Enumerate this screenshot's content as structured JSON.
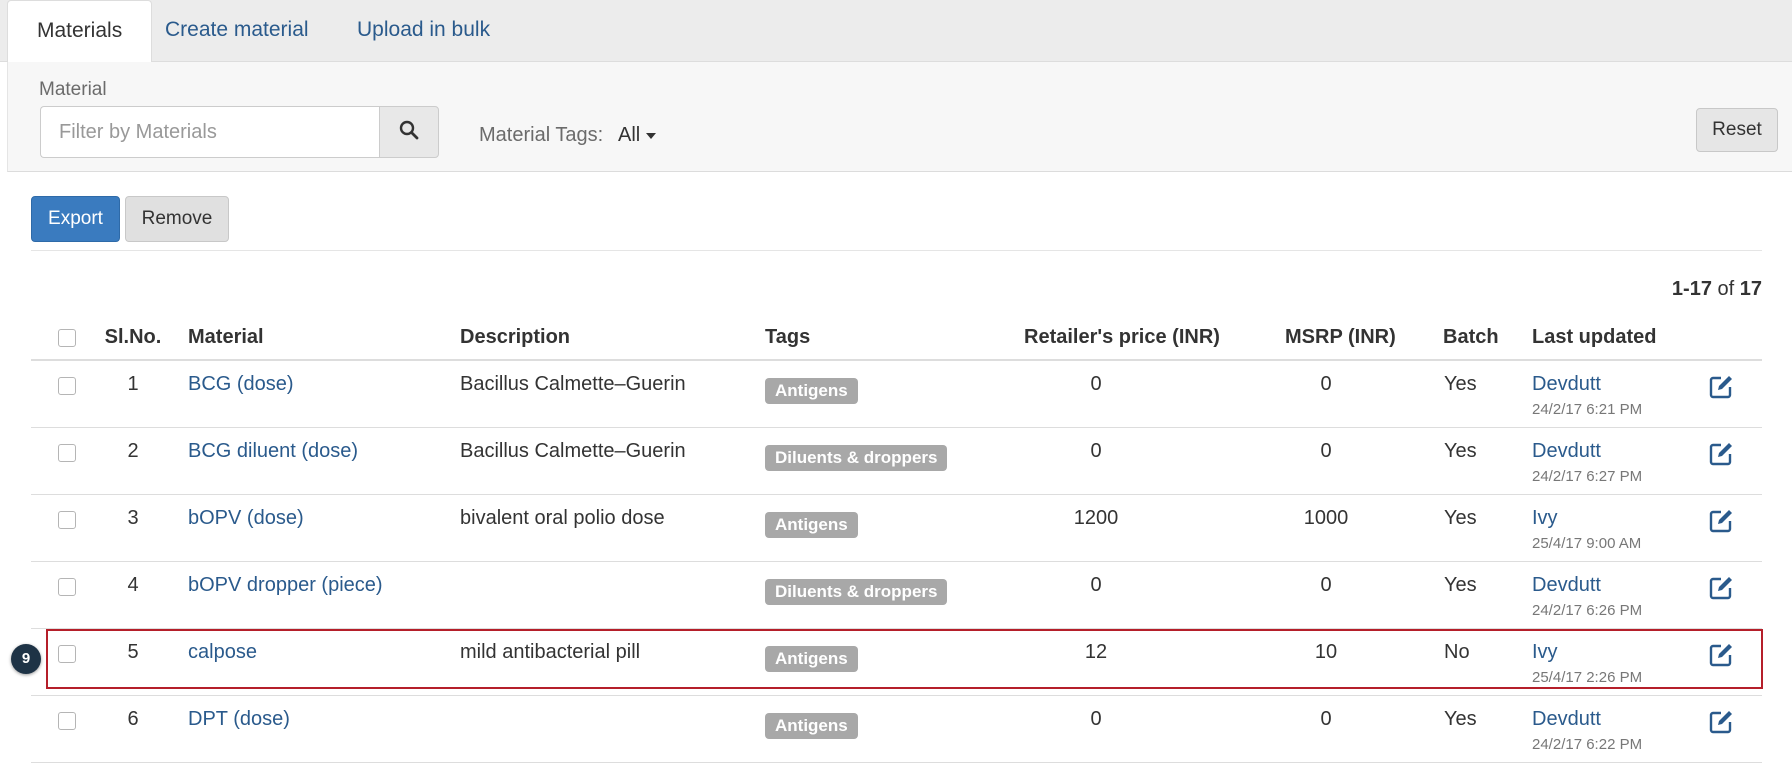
{
  "tabs": [
    {
      "label": "Materials",
      "active": true
    },
    {
      "label": "Create material",
      "active": false
    },
    {
      "label": "Upload in bulk",
      "active": false
    }
  ],
  "filter": {
    "label": "Material",
    "placeholder": "Filter by Materials",
    "value": "",
    "search_icon": "search-icon",
    "tags_label": "Material Tags:",
    "tags_value": "All",
    "reset_label": "Reset"
  },
  "actions": {
    "export_label": "Export",
    "remove_label": "Remove"
  },
  "pager": {
    "range": "1-17",
    "of": "of",
    "total": "17"
  },
  "table": {
    "headers": {
      "slno": "Sl.No.",
      "material": "Material",
      "description": "Description",
      "tags": "Tags",
      "retailer_price": "Retailer's price (INR)",
      "msrp": "MSRP (INR)",
      "batch": "Batch",
      "last_updated": "Last updated"
    },
    "rows": [
      {
        "slno": "1",
        "material": "BCG (dose)",
        "description": "Bacillus Calmette–Guerin",
        "tag": "Antigens",
        "retailer_price": "0",
        "msrp": "0",
        "batch": "Yes",
        "user": "Devdutt",
        "date": "24/2/17 6:21 PM"
      },
      {
        "slno": "2",
        "material": "BCG diluent (dose)",
        "description": "Bacillus Calmette–Guerin",
        "tag": "Diluents & droppers",
        "retailer_price": "0",
        "msrp": "0",
        "batch": "Yes",
        "user": "Devdutt",
        "date": "24/2/17 6:27 PM"
      },
      {
        "slno": "3",
        "material": "bOPV (dose)",
        "description": "bivalent oral polio dose",
        "tag": "Antigens",
        "retailer_price": "1200",
        "msrp": "1000",
        "batch": "Yes",
        "user": "Ivy",
        "date": "25/4/17 9:00 AM"
      },
      {
        "slno": "4",
        "material": "bOPV dropper (piece)",
        "description": "",
        "tag": "Diluents & droppers",
        "retailer_price": "0",
        "msrp": "0",
        "batch": "Yes",
        "user": "Devdutt",
        "date": "24/2/17 6:26 PM"
      },
      {
        "slno": "5",
        "material": "calpose",
        "description": "mild antibacterial pill",
        "tag": "Antigens",
        "retailer_price": "12",
        "msrp": "10",
        "batch": "No",
        "user": "Ivy",
        "date": "25/4/17 2:26 PM"
      },
      {
        "slno": "6",
        "material": "DPT (dose)",
        "description": "",
        "tag": "Antigens",
        "retailer_price": "0",
        "msrp": "0",
        "batch": "Yes",
        "user": "Devdutt",
        "date": "24/2/17 6:22 PM"
      }
    ]
  },
  "annotation": {
    "step_number": "9",
    "highlight_color": "#b51f2a"
  },
  "colors": {
    "primary": "#3a7bbf",
    "link": "#2a5a8c",
    "tag_bg": "#a8a8a8"
  }
}
